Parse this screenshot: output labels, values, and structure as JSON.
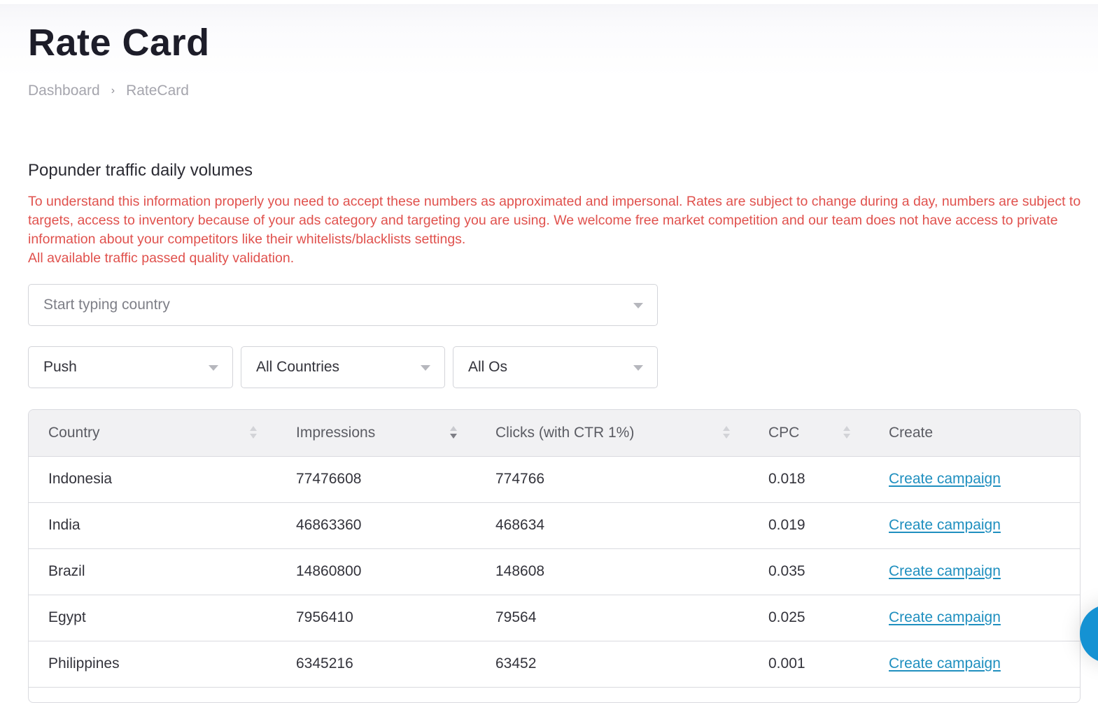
{
  "header": {
    "title": "Rate Card",
    "breadcrumb": [
      {
        "label": "Dashboard"
      },
      {
        "label": "RateCard"
      }
    ],
    "breadcrumb_separator": "›"
  },
  "section": {
    "title": "Popunder traffic daily volumes",
    "notice_lines": [
      "To understand this information properly you need to accept these numbers as approximated and impersonal. Rates are subject to change during a day, numbers are subject to targets, access to inventory because of your ads category and targeting you are using. We welcome free market competition and our team does not have access to private information about your competitors like their whitelists/blacklists settings.",
      "All available traffic passed quality validation."
    ],
    "notice_color": "#e0514d"
  },
  "filters": {
    "country_search": {
      "placeholder": "Start typing country",
      "value": ""
    },
    "traffic_type": {
      "selected": "Push"
    },
    "countries": {
      "selected": "All Countries"
    },
    "os": {
      "selected": "All Os"
    }
  },
  "table": {
    "columns": [
      {
        "label": "Country",
        "sortable": true,
        "sort": "none"
      },
      {
        "label": "Impressions",
        "sortable": true,
        "sort": "desc"
      },
      {
        "label": "Clicks (with CTR 1%)",
        "sortable": true,
        "sort": "none"
      },
      {
        "label": "CPC",
        "sortable": true,
        "sort": "none"
      },
      {
        "label": "Create",
        "sortable": false
      }
    ],
    "rows": [
      {
        "country": "Indonesia",
        "impressions": "77476608",
        "clicks": "774766",
        "cpc": "0.018",
        "create": "Create campaign"
      },
      {
        "country": "India",
        "impressions": "46863360",
        "clicks": "468634",
        "cpc": "0.019",
        "create": "Create campaign"
      },
      {
        "country": "Brazil",
        "impressions": "14860800",
        "clicks": "148608",
        "cpc": "0.035",
        "create": "Create campaign"
      },
      {
        "country": "Egypt",
        "impressions": "7956410",
        "clicks": "79564",
        "cpc": "0.025",
        "create": "Create campaign"
      },
      {
        "country": "Philippines",
        "impressions": "6345216",
        "clicks": "63452",
        "cpc": "0.001",
        "create": "Create campaign"
      }
    ],
    "link_color": "#1f8fbf"
  },
  "widgets": {
    "chat_button": {
      "icon": "chat-bubble-icon",
      "color": "#1592d3"
    }
  }
}
